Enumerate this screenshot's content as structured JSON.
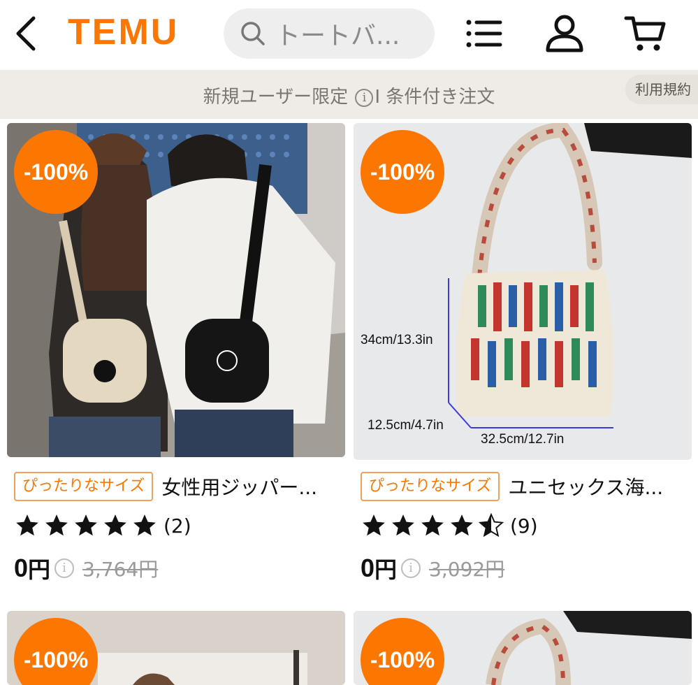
{
  "header": {
    "logo": "TEMU",
    "search_placeholder": "トートバ...",
    "accent": "#fb7701"
  },
  "promo": {
    "prefix": "新規ユーザー限定",
    "suffix": "I 条件付き注文",
    "terms": "利用規約"
  },
  "products": [
    {
      "badge": "-100%",
      "tag": "ぴったりなサイズ",
      "title": "女性用ジッパー...",
      "rating": 5,
      "reviews": "(2)",
      "price": "0",
      "currency": "円",
      "old_price": "3,764円"
    },
    {
      "badge": "-100%",
      "tag": "ぴったりなサイズ",
      "title": "ユニセックス海...",
      "rating": 4.5,
      "reviews": "(9)",
      "price": "0",
      "currency": "円",
      "old_price": "3,092円",
      "dims": {
        "height": "34cm/13.3in",
        "depth": "12.5cm/4.7in",
        "width": "32.5cm/12.7in"
      }
    },
    {
      "badge": "-100%"
    },
    {
      "badge": "-100%"
    }
  ],
  "icons": [
    "back-arrow-icon",
    "search-icon",
    "list-icon",
    "account-icon",
    "cart-icon",
    "info-icon",
    "star-icon",
    "half-star-icon"
  ]
}
